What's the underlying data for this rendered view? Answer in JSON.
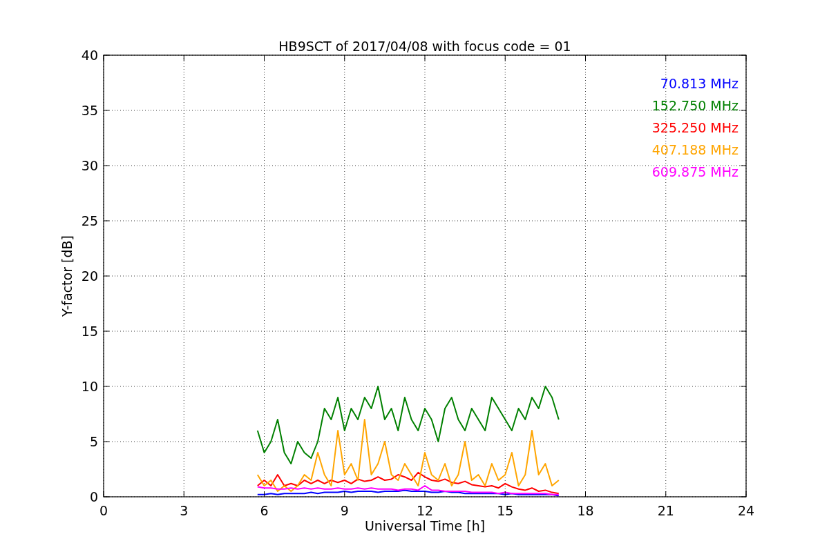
{
  "chart_data": {
    "type": "line",
    "title": "HB9SCT of 2017/04/08 with focus code = 01",
    "xlabel": "Universal Time [h]",
    "ylabel": "Y-factor [dB]",
    "x": [
      5.75,
      6,
      6.25,
      6.5,
      6.75,
      7,
      7.25,
      7.5,
      7.75,
      8,
      8.25,
      8.5,
      8.75,
      9,
      9.25,
      9.5,
      9.75,
      10,
      10.25,
      10.5,
      10.75,
      11,
      11.25,
      11.5,
      11.75,
      12,
      12.25,
      12.5,
      12.75,
      13,
      13.25,
      13.5,
      13.75,
      14,
      14.25,
      14.5,
      14.75,
      15,
      15.25,
      15.5,
      15.75,
      16,
      16.25,
      16.5,
      16.75,
      17
    ],
    "series": [
      {
        "name": "70.813 MHz",
        "color": "#0000ff",
        "values": [
          0.2,
          0.2,
          0.3,
          0.2,
          0.3,
          0.3,
          0.3,
          0.3,
          0.4,
          0.3,
          0.4,
          0.4,
          0.4,
          0.5,
          0.4,
          0.5,
          0.5,
          0.5,
          0.4,
          0.5,
          0.5,
          0.5,
          0.6,
          0.5,
          0.5,
          0.5,
          0.4,
          0.4,
          0.5,
          0.4,
          0.4,
          0.3,
          0.3,
          0.3,
          0.3,
          0.3,
          0.3,
          0.2,
          0.3,
          0.2,
          0.2,
          0.2,
          0.2,
          0.2,
          0.2,
          0.1
        ]
      },
      {
        "name": "152.750 MHz",
        "color": "#008000",
        "values": [
          6,
          4,
          5,
          7,
          4,
          3,
          5,
          4,
          3.5,
          5,
          8,
          7,
          9,
          6,
          8,
          7,
          9,
          8,
          10,
          7,
          8,
          6,
          9,
          7,
          6,
          8,
          7,
          5,
          8,
          9,
          7,
          6,
          8,
          7,
          6,
          9,
          8,
          7,
          6,
          8,
          7,
          9,
          8,
          10,
          9,
          7
        ]
      },
      {
        "name": "325.250 MHz",
        "color": "#ff0000",
        "values": [
          1,
          1.5,
          1,
          2,
          1,
          1.2,
          1,
          1.5,
          1.2,
          1.5,
          1.2,
          1.5,
          1.3,
          1.5,
          1.2,
          1.6,
          1.4,
          1.5,
          1.8,
          1.5,
          1.6,
          2,
          1.8,
          1.5,
          2.2,
          1.8,
          1.5,
          1.4,
          1.6,
          1.3,
          1.2,
          1.4,
          1.1,
          1,
          0.9,
          1,
          0.8,
          1.2,
          0.9,
          0.7,
          0.6,
          0.8,
          0.5,
          0.6,
          0.4,
          0.3
        ]
      },
      {
        "name": "407.188 MHz",
        "color": "#ffa500",
        "values": [
          2,
          1,
          1.5,
          0.5,
          1,
          0.5,
          1,
          2,
          1.5,
          4,
          2,
          1,
          6,
          2,
          3,
          1.5,
          7,
          2,
          3,
          5,
          2,
          1.5,
          3,
          2,
          1,
          4,
          2,
          1.5,
          3,
          1,
          2,
          5,
          1.5,
          2,
          1,
          3,
          1.5,
          2,
          4,
          1,
          2,
          6,
          2,
          3,
          1,
          1.5
        ]
      },
      {
        "name": "609.875 MHz",
        "color": "#ff00ff",
        "values": [
          0.9,
          0.8,
          0.8,
          0.7,
          0.7,
          0.8,
          0.7,
          0.8,
          0.7,
          0.8,
          0.7,
          0.7,
          0.8,
          0.7,
          0.7,
          0.8,
          0.7,
          0.8,
          0.7,
          0.7,
          0.7,
          0.6,
          0.7,
          0.7,
          0.6,
          1,
          0.6,
          0.6,
          0.5,
          0.5,
          0.5,
          0.5,
          0.4,
          0.4,
          0.4,
          0.4,
          0.3,
          0.4,
          0.3,
          0.3,
          0.3,
          0.3,
          0.3,
          0.3,
          0.2,
          0.2
        ]
      }
    ],
    "grid": true,
    "xlim": [
      0,
      24
    ],
    "ylim": [
      0,
      40
    ],
    "xticks": [
      0,
      3,
      6,
      9,
      12,
      15,
      18,
      21,
      24
    ],
    "yticks": [
      0,
      5,
      10,
      15,
      20,
      25,
      30,
      35,
      40
    ]
  }
}
